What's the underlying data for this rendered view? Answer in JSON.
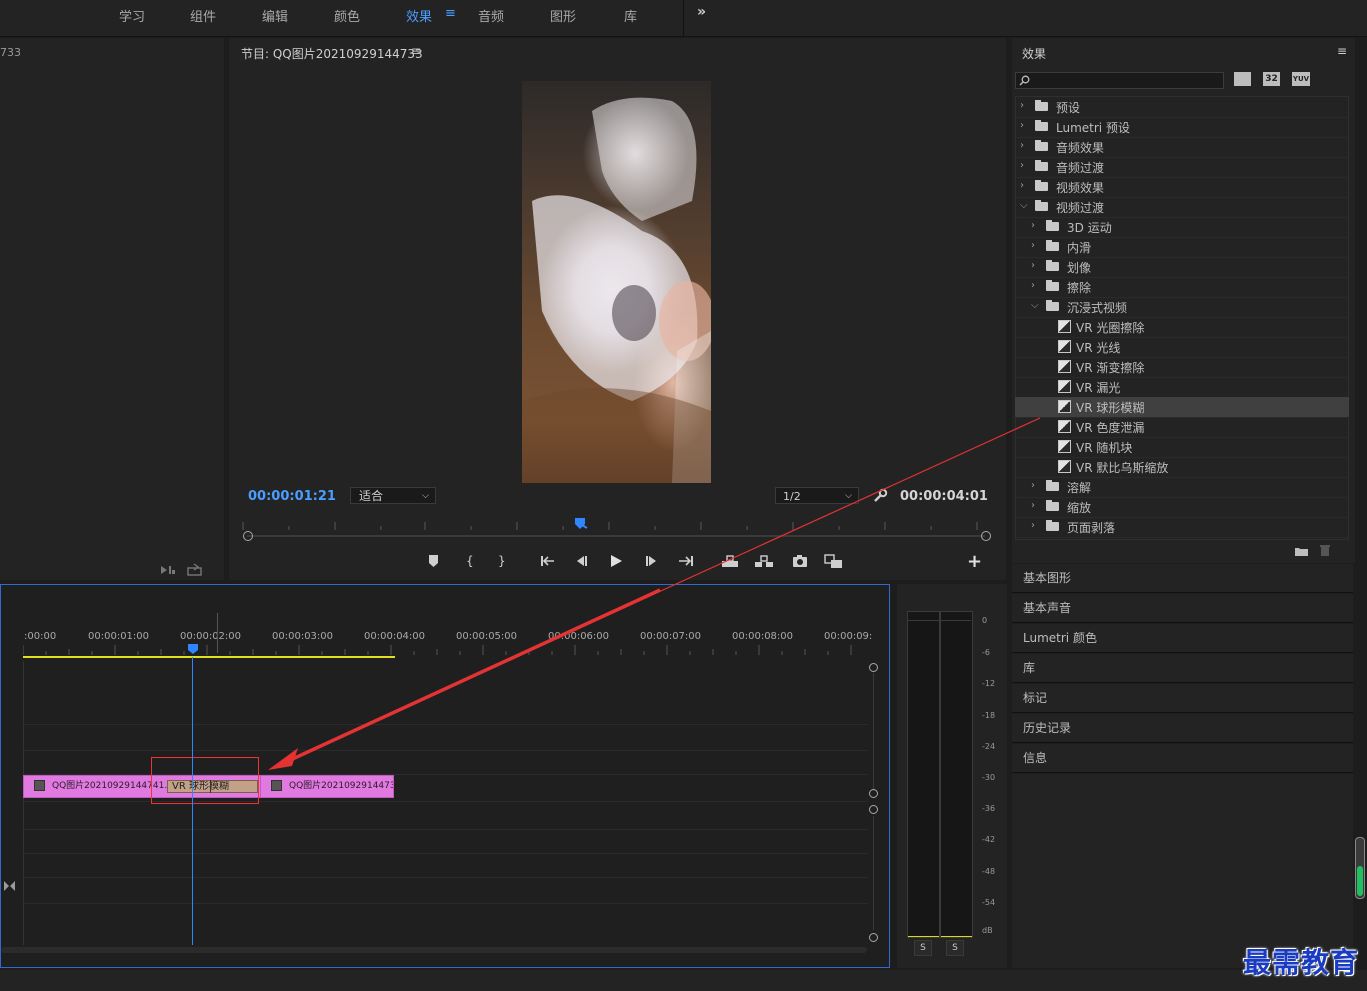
{
  "workspace_tabs": [
    "学习",
    "组件",
    "编辑",
    "颜色",
    "效果",
    "音频",
    "图形",
    "库"
  ],
  "active_workspace": "效果",
  "overflow_label": "»",
  "source_panel": {
    "title_fragment": "733"
  },
  "program_monitor": {
    "title": "节目: QQ图片20210929144733",
    "menu_icon": "≡",
    "current_timecode": "00:00:01:21",
    "fit_label": "适合",
    "resolution_label": "1/2",
    "duration_timecode": "00:00:04:01",
    "add_label": "+"
  },
  "effects_panel": {
    "title": "效果",
    "menu_icon": "≡",
    "badges": [
      "32",
      "YUV"
    ],
    "tree": [
      {
        "label": "预设",
        "level": 0,
        "expanded": false,
        "icon": "preset-folder"
      },
      {
        "label": "Lumetri 预设",
        "level": 0,
        "expanded": false,
        "icon": "preset-folder"
      },
      {
        "label": "音频效果",
        "level": 0,
        "expanded": false,
        "icon": "folder"
      },
      {
        "label": "音频过渡",
        "level": 0,
        "expanded": false,
        "icon": "folder"
      },
      {
        "label": "视频效果",
        "level": 0,
        "expanded": false,
        "icon": "folder"
      },
      {
        "label": "视频过渡",
        "level": 0,
        "expanded": true,
        "icon": "folder"
      },
      {
        "label": "3D 运动",
        "level": 1,
        "expanded": false,
        "icon": "folder"
      },
      {
        "label": "内滑",
        "level": 1,
        "expanded": false,
        "icon": "folder"
      },
      {
        "label": "划像",
        "level": 1,
        "expanded": false,
        "icon": "folder"
      },
      {
        "label": "擦除",
        "level": 1,
        "expanded": false,
        "icon": "folder"
      },
      {
        "label": "沉浸式视频",
        "level": 1,
        "expanded": true,
        "icon": "folder"
      },
      {
        "label": "VR 光圈擦除",
        "level": 2,
        "icon": "transition"
      },
      {
        "label": "VR 光线",
        "level": 2,
        "icon": "transition"
      },
      {
        "label": "VR 渐变擦除",
        "level": 2,
        "icon": "transition"
      },
      {
        "label": "VR 漏光",
        "level": 2,
        "icon": "transition"
      },
      {
        "label": "VR 球形模糊",
        "level": 2,
        "icon": "transition",
        "selected": true
      },
      {
        "label": "VR 色度泄漏",
        "level": 2,
        "icon": "transition"
      },
      {
        "label": "VR 随机块",
        "level": 2,
        "icon": "transition"
      },
      {
        "label": "VR 默比乌斯缩放",
        "level": 2,
        "icon": "transition"
      },
      {
        "label": "溶解",
        "level": 1,
        "expanded": false,
        "icon": "folder"
      },
      {
        "label": "缩放",
        "level": 1,
        "expanded": false,
        "icon": "folder"
      },
      {
        "label": "页面剥落",
        "level": 1,
        "expanded": false,
        "icon": "folder"
      }
    ]
  },
  "side_panels": [
    "基本图形",
    "基本声音",
    "Lumetri 颜色",
    "库",
    "标记",
    "历史记录",
    "信息"
  ],
  "timeline": {
    "ruler": [
      ":00:00",
      "00:00:01:00",
      "00:00:02:00",
      "00:00:03:00",
      "00:00:04:00",
      "00:00:05:00",
      "00:00:06:00",
      "00:00:07:00",
      "00:00:08:00",
      "00:00:09:"
    ],
    "clip1": "QQ图片20210929144741.",
    "transition": "VR 球形模糊",
    "clip2": "QQ图片2021092914473"
  },
  "audio_meter": {
    "scale": [
      "0",
      "-6",
      "-12",
      "-18",
      "-24",
      "-30",
      "-36",
      "-42",
      "-48",
      "-54",
      "dB"
    ],
    "solo_labels": [
      "S",
      "S"
    ]
  },
  "watermark": "最需教育",
  "colors": {
    "accent": "#4a9eff",
    "clip": "#e17ae0",
    "playhead": "#2f86ff",
    "annotation": "#e33333",
    "transition": "#c3a188"
  }
}
